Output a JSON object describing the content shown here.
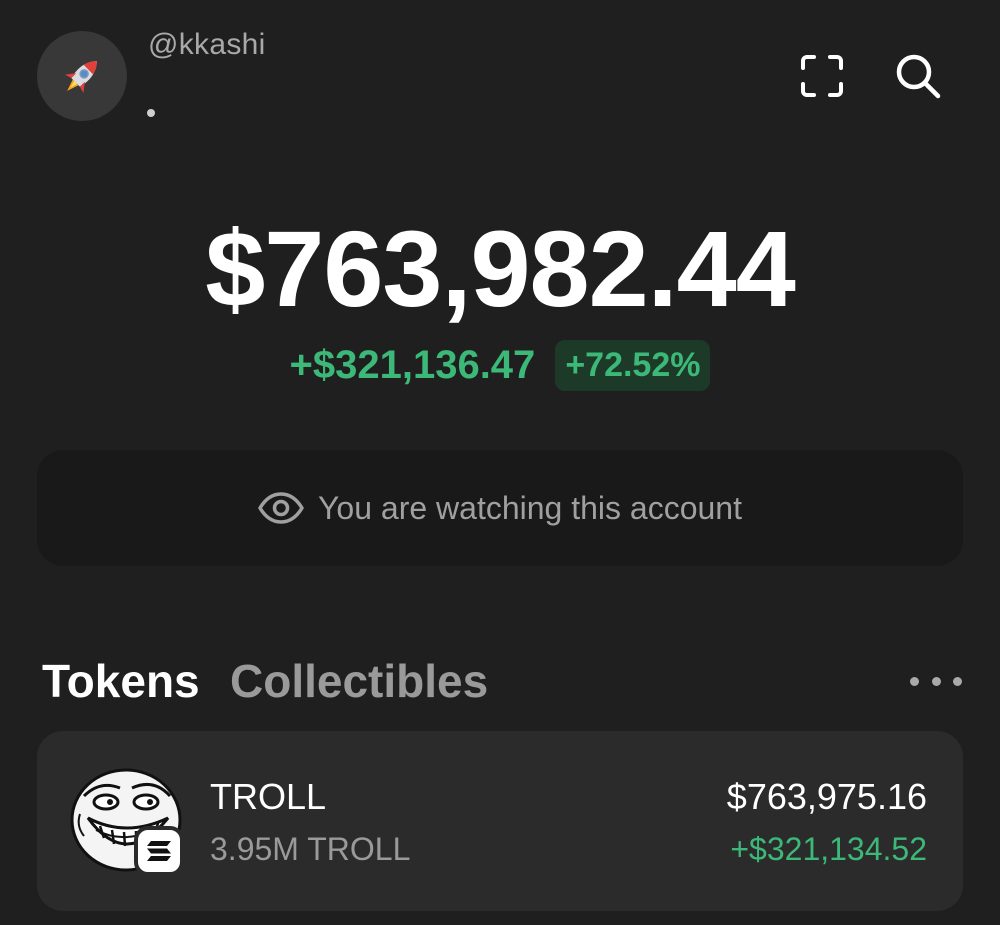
{
  "profile": {
    "username": "@kkashi",
    "avatar_icon": "rocket-icon"
  },
  "header": {
    "scan_icon": "scan-icon",
    "search_icon": "search-icon"
  },
  "portfolio": {
    "balance": "$763,982.44",
    "change_amount": "+$321,136.47",
    "change_percent": "+72.52%"
  },
  "watch_banner": {
    "icon": "eye-icon",
    "text": "You are watching this account"
  },
  "tabs": [
    {
      "label": "Tokens",
      "active": true
    },
    {
      "label": "Collectibles",
      "active": false
    }
  ],
  "tokens": [
    {
      "name": "TROLL",
      "quantity": "3.95M TROLL",
      "value": "$763,975.16",
      "change": "+$321,134.52",
      "logo_icon": "troll-face-icon",
      "chain_icon": "solana-icon"
    }
  ],
  "colors": {
    "background": "#1f1f1f",
    "positive": "#3cb878",
    "card": "#2b2b2b"
  }
}
